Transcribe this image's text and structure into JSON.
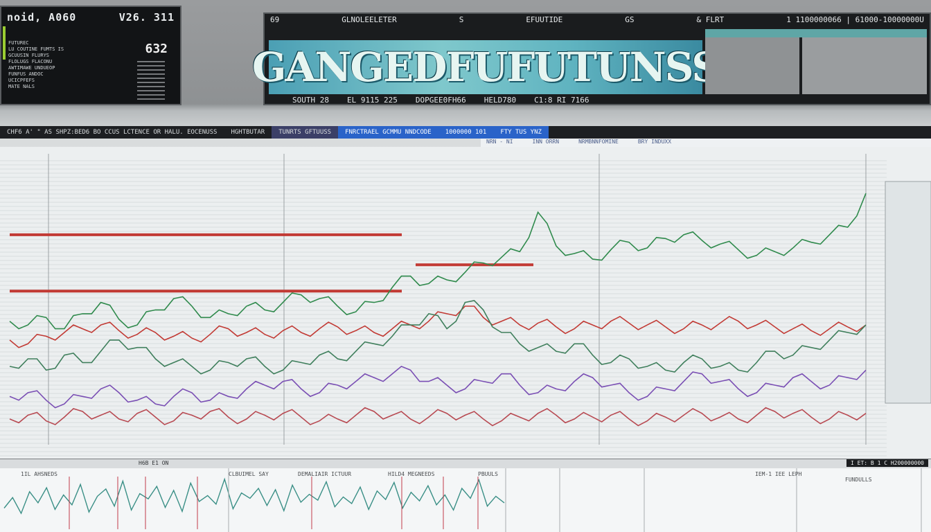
{
  "ticker": {
    "left_text": "noid, A060",
    "right_text": "V26. 311",
    "big_value": "632",
    "rows": [
      "FUTUREC",
      "LU COUTINE FUMTS  IS",
      "GCUUSIN FLURYS",
      "FLOLUGS FLACONU",
      "AWTIMAWE UNDUEOP",
      "FUNFUS ANDOC",
      "UCICPFEFS",
      "MATE NALS"
    ]
  },
  "banner": {
    "title": "GANGEDFUFUTUNSS",
    "top_texts": [
      "69",
      "GLNOLEELETER",
      "S",
      "EFUUTIDE",
      "GS",
      "& FLRT"
    ],
    "top_right": "1 1100000066  | 61000-10000000U",
    "bottom_texts": [
      "SOUTH 28",
      "EL 9115 225",
      "DOPGEE0FH66",
      "HELD780",
      "C1:8  RI 7166"
    ]
  },
  "strip": {
    "segments": [
      "CHF6 A' \"  AS   SHPZ:BED6  BO  CCUS LCTENCE  OR  HALU. EOCENUSS",
      "HGHTBUTAR",
      "TUNRTS GFTUUSS",
      "FNRCTRAEL GCMMU NNDCODE",
      "1000000 101",
      "FTY TUS  YNZ"
    ],
    "sub": [
      "NRN - NI",
      "INN   ORRN",
      "NRMBNNFOMINE",
      "BRY INDUXX"
    ]
  },
  "chart_data": {
    "type": "line",
    "title": "",
    "xlabel": "",
    "ylabel": "",
    "series": [
      {
        "name": "",
        "color": "#2f8a4c",
        "values": [
          62,
          60,
          64,
          58,
          66,
          72,
          63,
          60,
          68,
          74,
          70,
          64,
          66,
          70,
          68,
          72,
          76,
          74,
          70,
          67,
          72,
          80,
          86,
          82,
          84,
          88,
          93,
          96,
          99,
          120,
          102,
          98,
          95,
          100,
          104,
          101,
          106,
          108,
          105,
          103,
          100,
          97,
          99,
          101,
          104,
          108,
          112,
          130
        ]
      },
      {
        "name": "",
        "color": "#c23a34",
        "values": [
          52,
          50,
          54,
          56,
          58,
          60,
          57,
          55,
          56,
          54,
          53,
          55,
          58,
          56,
          55,
          57,
          56,
          58,
          59,
          57,
          56,
          58,
          60,
          62,
          66,
          70,
          64,
          62,
          60,
          61,
          59,
          58,
          60,
          62,
          61,
          60,
          59,
          58,
          60,
          61,
          62,
          60,
          59,
          58,
          57,
          58,
          59,
          60
        ]
      },
      {
        "name": "",
        "color": "#3f7f5c",
        "values": [
          38,
          42,
          36,
          44,
          40,
          46,
          52,
          48,
          42,
          40,
          38,
          36,
          40,
          42,
          38,
          36,
          40,
          44,
          42,
          46,
          50,
          54,
          60,
          66,
          58,
          72,
          68,
          56,
          50,
          48,
          46,
          50,
          44,
          40,
          42,
          38,
          36,
          40,
          42,
          38,
          36,
          40,
          46,
          44,
          48,
          52,
          56,
          60
        ]
      },
      {
        "name": "",
        "color": "#7a4fb4",
        "values": [
          22,
          24,
          20,
          18,
          22,
          26,
          24,
          20,
          18,
          22,
          24,
          20,
          22,
          26,
          28,
          30,
          26,
          24,
          28,
          30,
          32,
          34,
          36,
          30,
          28,
          26,
          30,
          34,
          28,
          24,
          26,
          30,
          32,
          28,
          24,
          22,
          26,
          30,
          34,
          30,
          26,
          24,
          28,
          32,
          30,
          28,
          32,
          36
        ]
      },
      {
        "name": "",
        "color": "#b84a52",
        "values": [
          10,
          12,
          9,
          11,
          14,
          12,
          10,
          13,
          11,
          9,
          12,
          14,
          11,
          10,
          12,
          13,
          11,
          9,
          10,
          12,
          14,
          12,
          10,
          11,
          13,
          12,
          10,
          9,
          11,
          13,
          12,
          10,
          11,
          12,
          10,
          9,
          11,
          12,
          13,
          11,
          10,
          12,
          14,
          13,
          11,
          10,
          12,
          13
        ]
      }
    ],
    "levels": [
      {
        "value": 108,
        "color": "#c23a34"
      },
      {
        "value": 92,
        "color": "#c23a34"
      },
      {
        "value": 78,
        "color": "#c23a34"
      }
    ],
    "ylim": [
      0,
      140
    ],
    "grid": true
  },
  "oscillator": {
    "values": [
      30,
      46,
      22,
      55,
      38,
      61,
      28,
      50,
      35,
      66,
      24,
      48,
      59,
      33,
      71,
      27,
      52,
      44,
      63,
      31,
      57,
      25,
      68,
      40,
      49,
      36,
      74,
      29,
      53,
      45,
      60,
      34,
      58,
      26,
      65,
      39,
      51,
      42,
      70,
      32,
      47,
      37,
      62,
      28,
      56,
      43,
      69,
      30,
      54,
      41,
      64,
      35,
      50,
      27,
      60,
      45,
      73,
      33,
      48,
      38
    ]
  },
  "bottom": {
    "label_left": "H6B E1 ON",
    "label_right": "I ET: B  1 C  H200000000",
    "labels": [
      "1IL AHSNEDS",
      "CLBUIMEL SAY",
      "DEMALIAIR ICTUUR",
      "HILD4 MEGNEEDS",
      "PBUULS",
      "IEM-1 IEE   LEPH",
      "FUNDULLS"
    ]
  },
  "colors": {
    "accent": "#4b9fb4",
    "up": "#2f8a4c",
    "down": "#c23a34"
  }
}
